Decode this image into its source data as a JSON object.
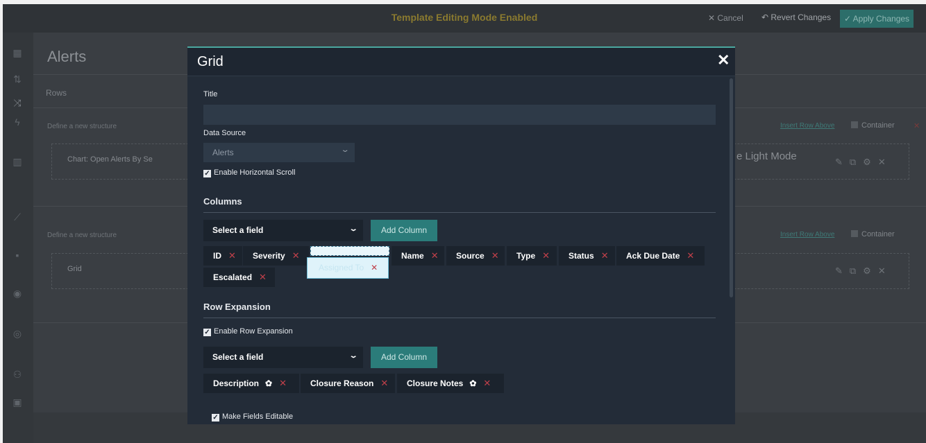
{
  "topbar": {
    "mode_text": "Template Editing Mode Enabled",
    "cancel_label": "✕ Cancel",
    "revert_label": "↶ Revert Changes",
    "apply_label": "✓ Apply Changes"
  },
  "background": {
    "page_title": "Alerts",
    "rows_label": "Rows",
    "define_structure": "Define a new structure",
    "insert_row_above": "Insert Row Above",
    "container_label": "Container",
    "row1_item": "Chart: Open Alerts By Se",
    "row1_right_text": "e Light Mode",
    "row2_item": "Grid"
  },
  "modal": {
    "title": "Grid",
    "close_icon": "✕",
    "title_label": "Title",
    "title_value": "",
    "data_source_label": "Data Source",
    "data_source_value": "Alerts",
    "enable_horizontal_scroll": "Enable Horizontal Scroll",
    "columns_heading": "Columns",
    "select_field_placeholder": "Select a field",
    "add_column_label": "Add Column",
    "columns": [
      {
        "label": "ID"
      },
      {
        "label": "Severity"
      },
      {
        "label": "Name"
      },
      {
        "label": "Source"
      },
      {
        "label": "Type"
      },
      {
        "label": "Status"
      },
      {
        "label": "Ack Due Date"
      },
      {
        "label": "Escalated"
      }
    ],
    "dragging_column": "Assigned To",
    "row_expansion_heading": "Row Expansion",
    "enable_row_expansion": "Enable Row Expansion",
    "expansion_select_placeholder": "Select a field",
    "expansion_add_column_label": "Add Column",
    "expansion_columns": [
      {
        "label": "Description",
        "has_gear": true
      },
      {
        "label": "Closure Reason",
        "has_gear": false
      },
      {
        "label": "Closure Notes",
        "has_gear": true
      }
    ],
    "make_fields_editable": "Make Fields Editable"
  },
  "colors": {
    "modal_bg": "#232c38",
    "chip_bg": "#1b232d",
    "accent": "#2b7c7a",
    "remove_x": "#c0404a"
  }
}
